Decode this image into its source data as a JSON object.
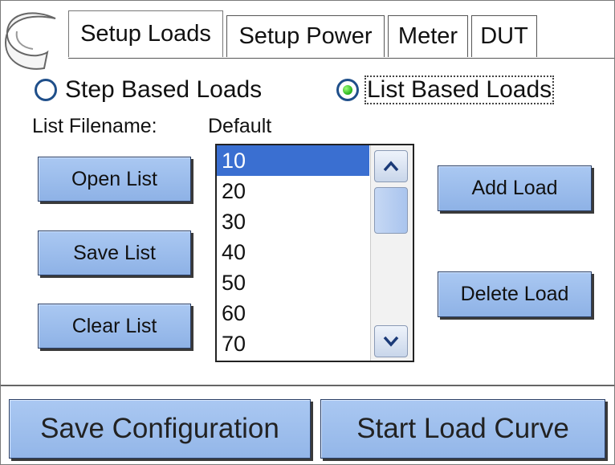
{
  "tabs": [
    {
      "label": "Setup Loads",
      "active": true
    },
    {
      "label": "Setup Power",
      "active": false
    },
    {
      "label": "Meter",
      "active": false
    },
    {
      "label": "DUT",
      "active": false
    }
  ],
  "mode": {
    "step_label": "Step Based Loads",
    "list_label": "List Based Loads",
    "selected": "list"
  },
  "filename": {
    "label": "List Filename:",
    "value": "Default"
  },
  "left_buttons": {
    "open": "Open List",
    "save": "Save List",
    "clear": "Clear List"
  },
  "right_buttons": {
    "add": "Add Load",
    "delete": "Delete Load"
  },
  "load_list": {
    "items": [
      "10",
      "20",
      "30",
      "40",
      "50",
      "60",
      "70"
    ],
    "selected_index": 0
  },
  "bottom": {
    "save_config": "Save Configuration",
    "start_curve": "Start Load Curve"
  },
  "icons": {
    "back": "back-arrow-icon",
    "up": "chevron-up-icon",
    "down": "chevron-down-icon"
  },
  "colors": {
    "button": "#9dbcee",
    "selection": "#3a6fd1",
    "radio_on": "#24b21a"
  }
}
